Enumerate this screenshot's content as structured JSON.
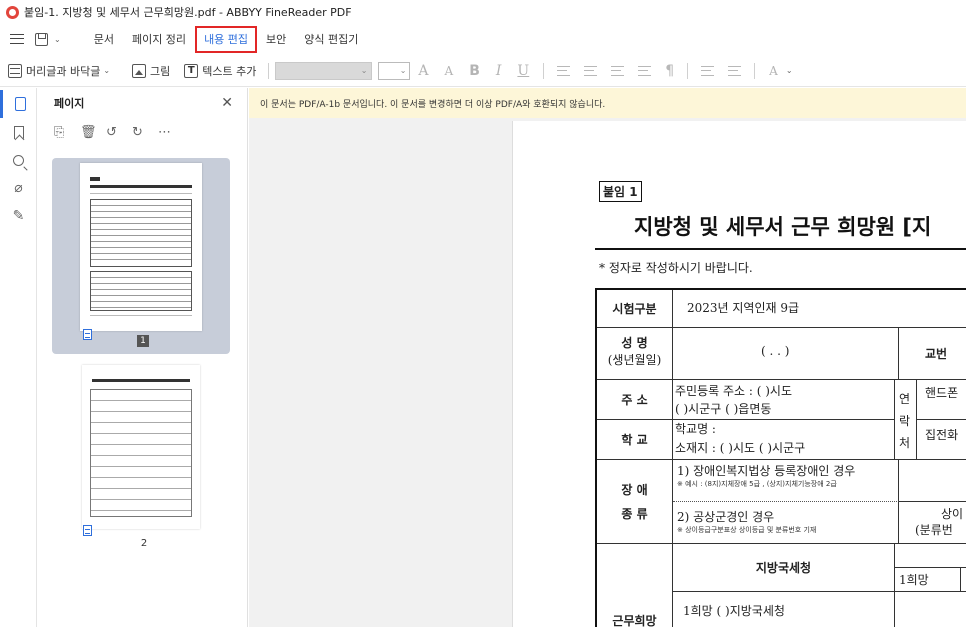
{
  "window": {
    "title": "붙임-1. 지방청 및 세무서 근무희망원.pdf - ABBYY FineReader PDF"
  },
  "menu": {
    "items": [
      "문서",
      "페이지 정리",
      "내용 편집",
      "보안",
      "양식 편집기"
    ],
    "active": "내용 편집"
  },
  "toolbar": {
    "header_footer": "머리글과 바닥글",
    "picture": "그림",
    "add_text": "텍스트 추가",
    "format_glyphs": {
      "grow": "A",
      "shrink": "A",
      "bold": "B",
      "italic": "I",
      "underline": "U",
      "color": "A"
    }
  },
  "panel": {
    "title": "페이지",
    "close": "✕",
    "pages": [
      "1",
      "2"
    ],
    "selected_page": "1"
  },
  "banner": {
    "text": "이 문서는 PDF/A-1b 문서입니다. 이 문서를 변경하면 더 이상 PDF/A와 호환되지 않습니다."
  },
  "document": {
    "attach_label": "붙임 1",
    "title": "지방청 및 세무서 근무 희망원 [지",
    "note": "* 정자로 작성하시기 바랍니다.",
    "form": {
      "exam_label": "시험구분",
      "exam_value": "2023년 지역인재 9급",
      "name_label": "성 명",
      "birth_label": "(생년월일)",
      "birth_value": "(       .       .       )",
      "teacher_no_label": "교번",
      "address_label": "주 소",
      "address_line1": "주민등록 주소 : (           )시도",
      "address_line2": "(           )시군구 (           )읍면동",
      "contact_label": "연락처",
      "phone_label": "핸드폰",
      "home_label": "집전화",
      "school_label": "학 교",
      "school_line1": "학교명 :",
      "school_line2": "소재지 : (           )시도 (          )시군구",
      "disability_label1": "장 애",
      "disability_label2": "종 류",
      "disability_1": "1) 장애인복지법상 등록장애인 경우",
      "disability_1_example": "※ 예시 : (8지)지체장애 5급 , (상지)지체기능장애 2급",
      "disability_2": "2) 공상군경인 경우",
      "disability_2_example": "※ 상이등급구분표상 상이등급 및 분류번호 기재",
      "grade_label": "상이",
      "grade_sub": "(분류번",
      "regional_office": "지방국세청",
      "first_choice": "1희망",
      "first_choice_value": "1희망    (          )지방국세청",
      "work_hope_label": "근무희망"
    }
  },
  "colors": {
    "accent": "#2f6fdc",
    "highlight_border": "#e22626",
    "banner_bg": "#fdf6d8",
    "selected_thumb_bg": "#c7cdd9"
  }
}
